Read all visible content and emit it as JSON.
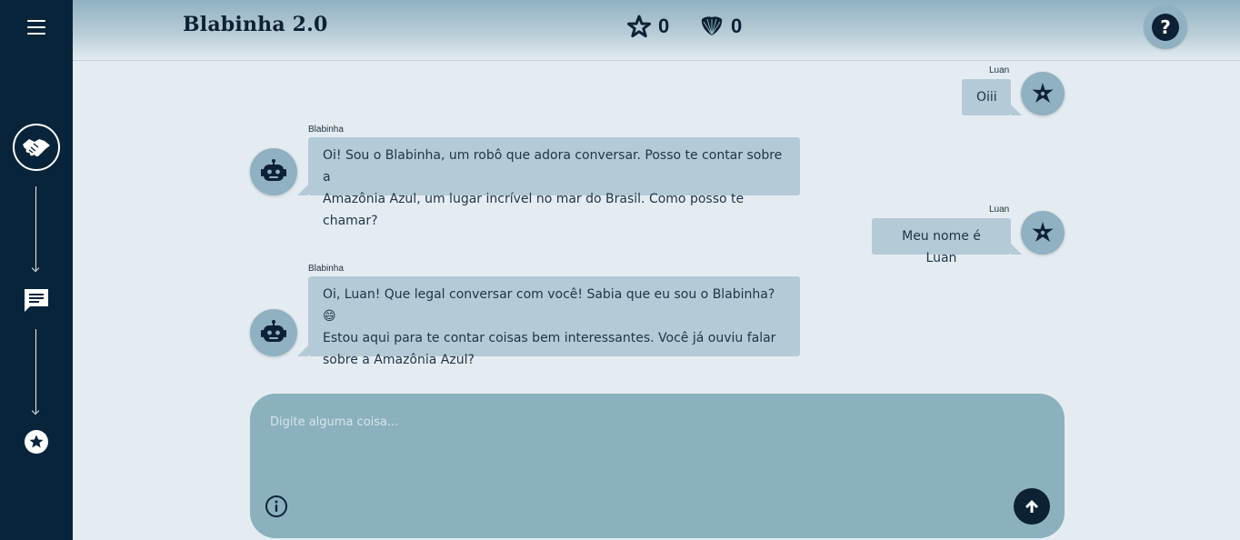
{
  "app": {
    "title": "Blabinha 2.0"
  },
  "header": {
    "stars_count": "0",
    "shells_count": "0",
    "help_label": "?"
  },
  "sidebar": {
    "items": [
      "menu-icon",
      "handshake-icon",
      "chat-icon",
      "star-icon"
    ]
  },
  "chat": {
    "messages": [
      {
        "sender": "Luan",
        "role": "user",
        "text": "Oiii"
      },
      {
        "sender": "Blabinha",
        "role": "bot",
        "lines": [
          "Oi! Sou o Blabinha, um robô que adora conversar. Posso te contar sobre a",
          "Amazônia Azul, um lugar incrível no mar do Brasil. Como posso te chamar?"
        ]
      },
      {
        "sender": "Luan",
        "role": "user",
        "text": "Meu nome é Luan"
      },
      {
        "sender": "Blabinha",
        "role": "bot",
        "lines": [
          "Oi, Luan! Que legal conversar com você! Sabia que eu sou o Blabinha? 😄",
          "Estou aqui para te contar coisas bem interessantes. Você já ouviu falar",
          "sobre a Amazônia Azul?"
        ]
      }
    ]
  },
  "composer": {
    "placeholder": "Digite alguma coisa...",
    "value": ""
  },
  "colors": {
    "sidebar": "#07243a",
    "accent": "#8fb1c1",
    "bubble": "#b4cad6",
    "dark": "#0c2134"
  }
}
